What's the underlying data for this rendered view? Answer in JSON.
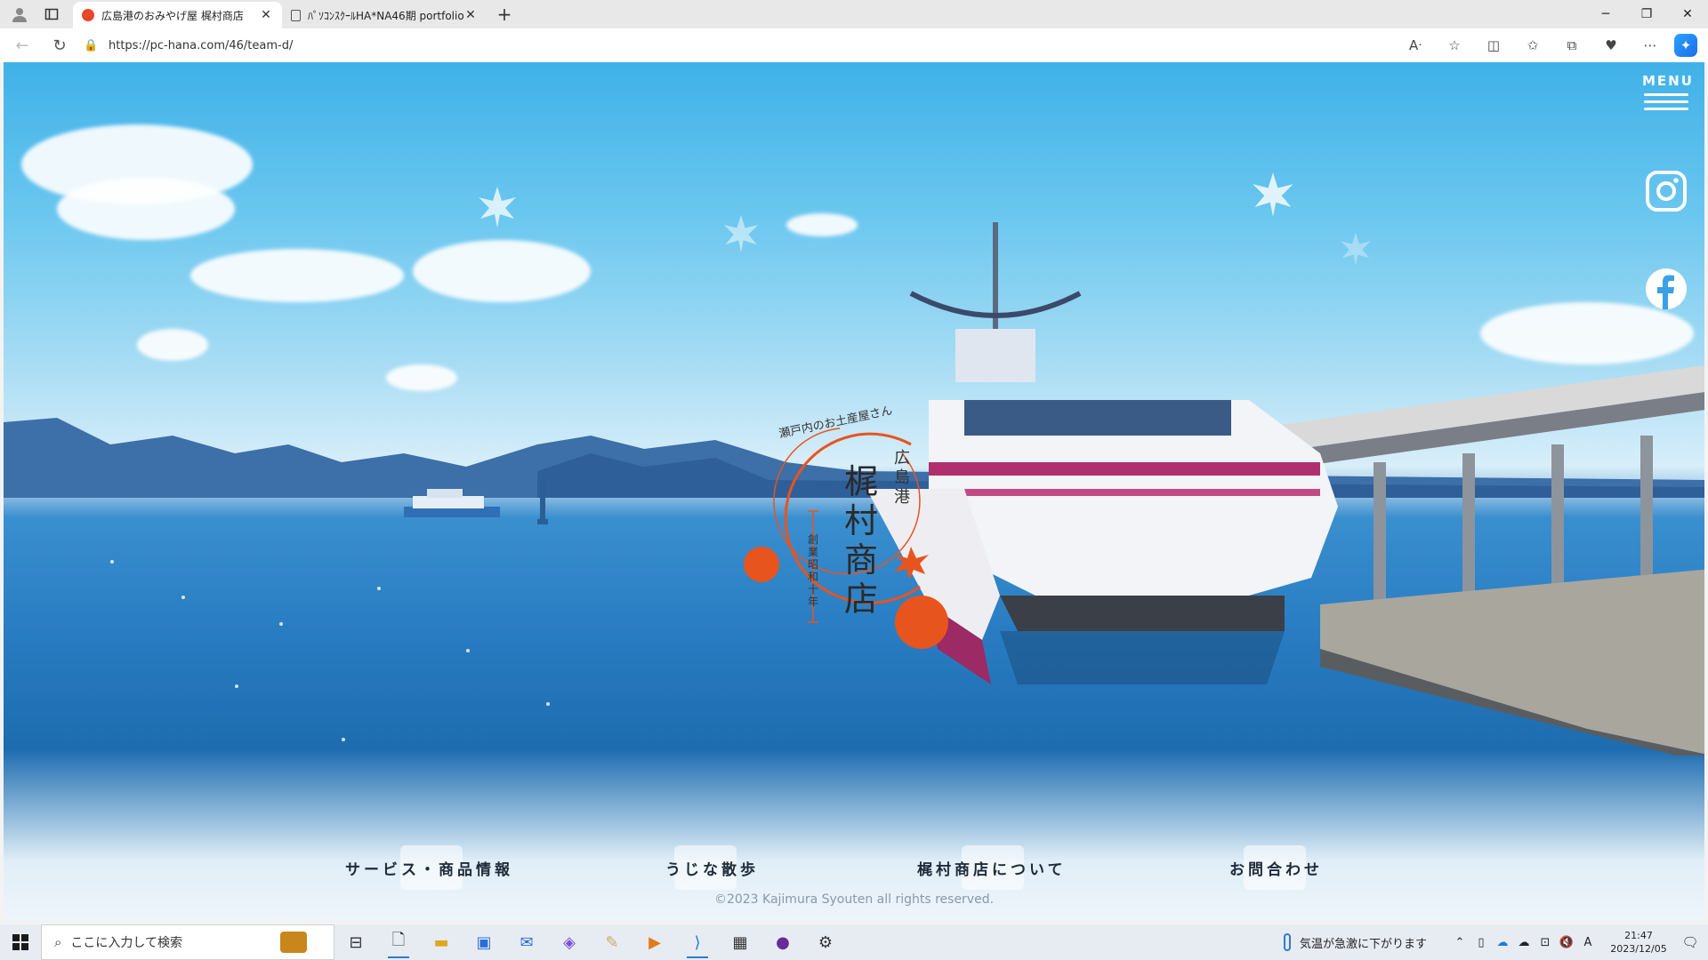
{
  "browser": {
    "tabs": [
      {
        "title": "広島港のおみやげ屋 梶村商店",
        "active": true
      },
      {
        "title": "ﾊﾟｿｺﾝｽｸｰﾙHA*NA46期 portfolio!",
        "active": false
      }
    ],
    "url": "https://pc-hana.com/46/team-d/"
  },
  "site": {
    "menu_label": "MENU",
    "logo": {
      "name": "梶村商店",
      "tagline": "瀬戸内のお土産屋さん",
      "place": "広島港",
      "founded": "創業昭和十年"
    },
    "nav": [
      {
        "label": "サービス・商品情報"
      },
      {
        "label": "うじな散歩"
      },
      {
        "label": "梶村商店について"
      },
      {
        "label": "お問合わせ"
      }
    ],
    "copyright": "©2023 Kajimura Syouten all rights reserved.",
    "colors": {
      "accent": "#e8541e",
      "sky": "#4fb6e8",
      "sea": "#1f6fb4"
    }
  },
  "taskbar": {
    "search_placeholder": "ここに入力して検索",
    "weather_text": "気温が急激に下がります",
    "time": "21:47",
    "date": "2023/12/05",
    "ime": "A"
  }
}
